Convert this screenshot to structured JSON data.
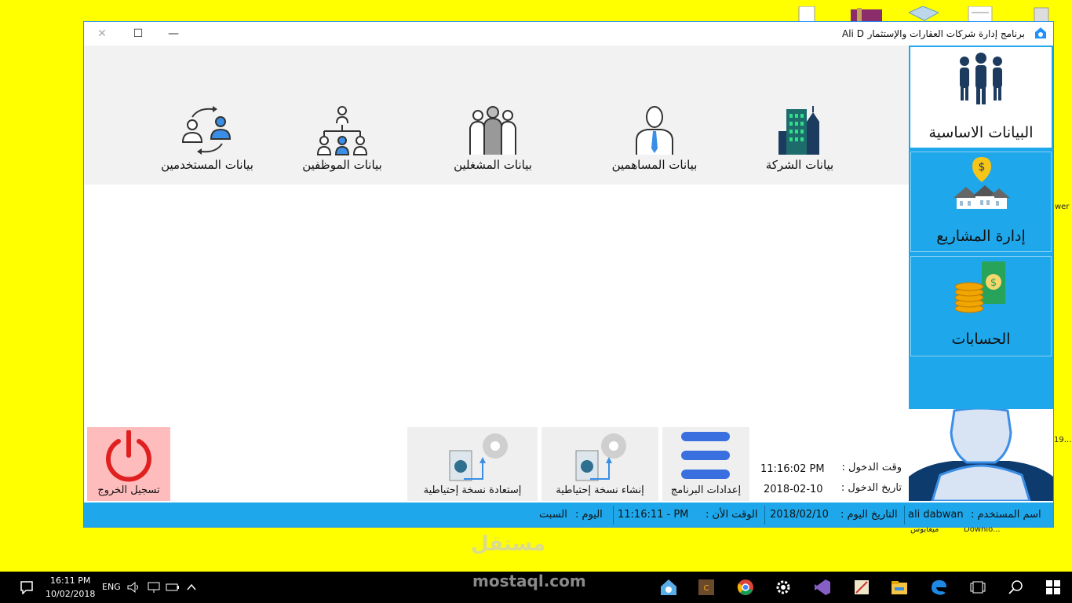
{
  "window": {
    "title": "برنامج إدارة شركات العقارات والإستثمار",
    "user": "Ali D",
    "controls": {
      "close": "✕",
      "maximize": "☐",
      "minimize": "—"
    }
  },
  "submenu": {
    "items": [
      {
        "id": "company",
        "label": "بيانات الشركة"
      },
      {
        "id": "shareholders",
        "label": "بيانات المساهمين"
      },
      {
        "id": "operators",
        "label": "بيانات المشغلين"
      },
      {
        "id": "employees",
        "label": "بيانات الموظفين"
      },
      {
        "id": "users",
        "label": "بيانات المستخدمين"
      }
    ]
  },
  "sidebar": {
    "items": [
      {
        "id": "basic-data",
        "label": "البيانات الاساسية"
      },
      {
        "id": "projects",
        "label": "إدارة المشاريع"
      },
      {
        "id": "accounts",
        "label": "الحسابات"
      }
    ]
  },
  "tiles": {
    "settings": "إعدادات البرنامج",
    "backup": "إنشاء نسخة إحتياطية",
    "restore": "إستعادة نسخة إحتياطية",
    "logout": "تسجيل الخروج"
  },
  "login": {
    "time_label": "وقت الدخول :",
    "time_value": "11:16:02 PM",
    "date_label": "تاريخ الدخول :",
    "date_value": "2018-02-10"
  },
  "status": {
    "user_label": "اسم المستخدم :",
    "user_value": "ali dabwan",
    "date_label": "التاريخ اليوم :",
    "date_value": "2018/02/10",
    "now_label": "الوقت الأن :",
    "now_value": "11:16:11 - PM",
    "day_label": "اليوم :",
    "day_value": "السبت"
  },
  "taskbar": {
    "time": "16:11 PM",
    "date": "10/02/2018",
    "lang": "ENG"
  },
  "desktop": {
    "labels": [
      "Downlo...",
      "ميغابوس",
      "wer",
      "19..."
    ]
  },
  "watermark": {
    "arabic": "مستقل",
    "latin": "mostaql.com"
  },
  "colors": {
    "accent": "#1ea7ea",
    "desktop": "#ffff00",
    "logout": "#ffbcbc",
    "power": "#e02020"
  }
}
